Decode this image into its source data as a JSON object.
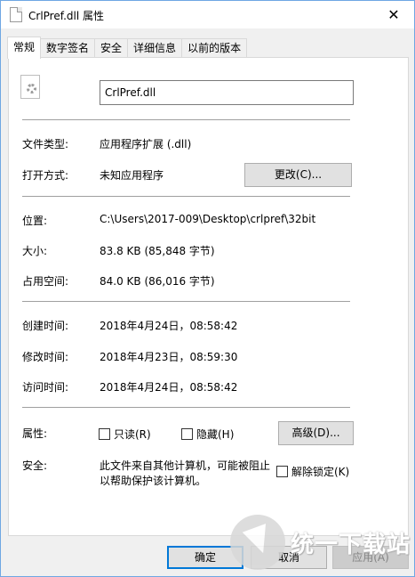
{
  "window": {
    "title": "CrlPref.dll 属性",
    "close_glyph": "✕"
  },
  "tabs": [
    {
      "label": "常规",
      "active": true
    },
    {
      "label": "数字签名",
      "active": false
    },
    {
      "label": "安全",
      "active": false
    },
    {
      "label": "详细信息",
      "active": false
    },
    {
      "label": "以前的版本",
      "active": false
    }
  ],
  "file": {
    "icon": "dll-gear-file-icon",
    "name": "CrlPref.dll"
  },
  "type_section": {
    "file_type_label": "文件类型:",
    "file_type_value": "应用程序扩展 (.dll)",
    "opens_with_label": "打开方式:",
    "opens_with_value": "未知应用程序",
    "change_button": "更改(C)..."
  },
  "location_section": {
    "location_label": "位置:",
    "location_value": "C:\\Users\\2017-009\\Desktop\\crlpref\\32bit",
    "size_label": "大小:",
    "size_value": "83.8 KB (85,848 字节)",
    "size_on_disk_label": "占用空间:",
    "size_on_disk_value": "84.0 KB (86,016 字节)"
  },
  "time_section": {
    "created_label": "创建时间:",
    "created_value": "2018年4月24日，08:58:42",
    "modified_label": "修改时间:",
    "modified_value": "2018年4月23日，08:59:30",
    "accessed_label": "访问时间:",
    "accessed_value": "2018年4月24日，08:58:42"
  },
  "attributes_section": {
    "attributes_label": "属性:",
    "readonly_label": "只读(R)",
    "readonly_checked": false,
    "hidden_label": "隐藏(H)",
    "hidden_checked": false,
    "advanced_button": "高级(D)...",
    "security_label": "安全:",
    "security_text_line1": "此文件来自其他计算机，可能被阻止",
    "security_text_line2": "以帮助保护该计算机。",
    "unblock_label": "解除锁定(K)",
    "unblock_checked": false
  },
  "footer": {
    "ok_button": "确定",
    "cancel_button": "取消",
    "apply_button": "应用(A)"
  },
  "watermark": {
    "text": "统一下载站"
  },
  "colors": {
    "accent": "#0078d7",
    "window_border": "#6fa7e3"
  }
}
